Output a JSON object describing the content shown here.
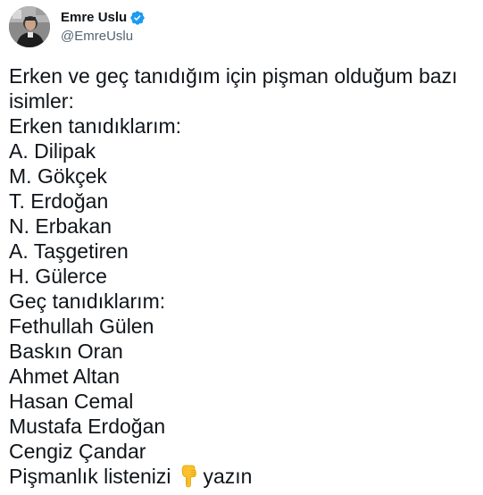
{
  "author": {
    "display_name": "Emre Uslu",
    "handle": "@EmreUslu",
    "verified": true,
    "avatar_icon": "profile-photo",
    "verified_icon": "verified-badge-icon"
  },
  "tweet": {
    "intro": "Erken ve geç tanıdığım için pişman olduğum bazı isimler:",
    "early_heading": "Erken tanıdıklarım:",
    "early_list": [
      "A. Dilipak",
      "M. Gökçek",
      "T. Erdoğan",
      "N. Erbakan",
      "A. Taşgetiren",
      "H. Gülerce"
    ],
    "late_heading": "Geç tanıdıklarım:",
    "late_list": [
      "Fethullah Gülen",
      "Baskın Oran",
      "Ahmet Altan",
      "Hasan Cemal",
      "Mustafa Erdoğan",
      "Cengiz Çandar"
    ],
    "closing_before": "Pişmanlık listenizi",
    "closing_emoji": "pointing-down-hand-icon",
    "closing_after": "yazın"
  },
  "colors": {
    "text": "#0f1419",
    "secondary": "#536471",
    "verified": "#1d9bf0",
    "emoji": "#fbc02d"
  }
}
